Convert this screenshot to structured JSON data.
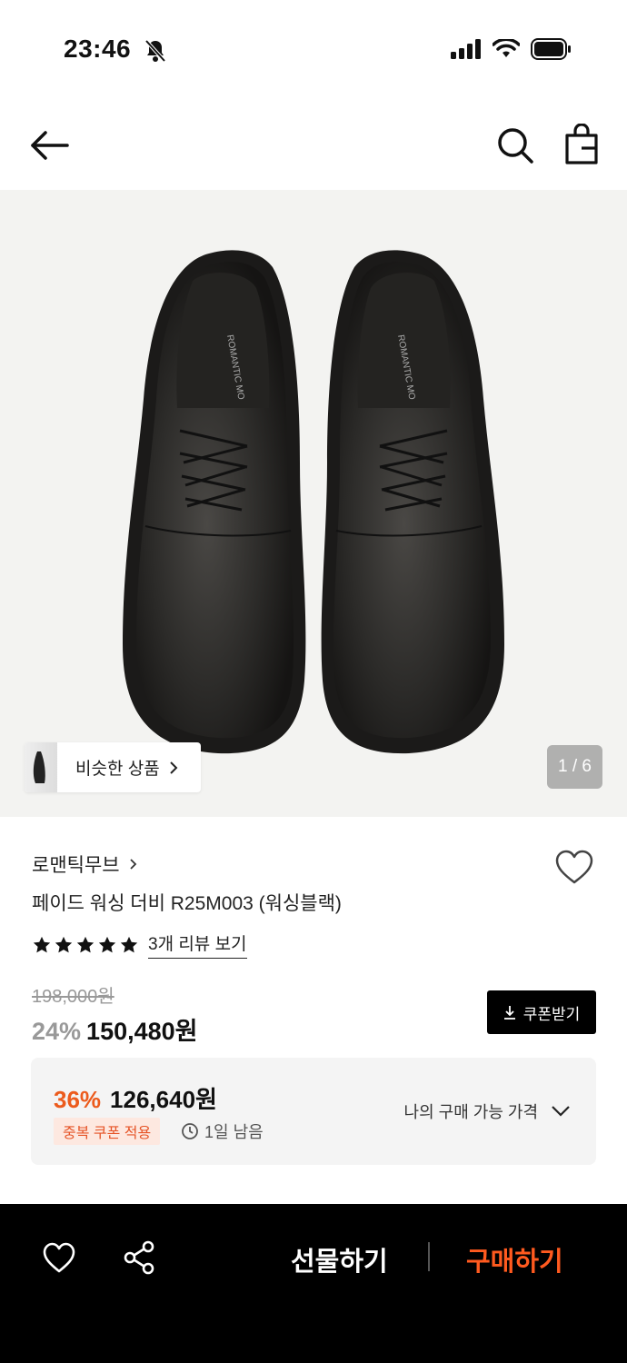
{
  "status_bar": {
    "time": "23:46"
  },
  "gallery": {
    "similar_label": "비슷한 상품",
    "counter": "1 / 6"
  },
  "product": {
    "brand": "로맨틱무브",
    "title": "페이드 워싱 더비 R25M003 (워싱블랙)",
    "rating": 5,
    "review_link": "3개 리뷰 보기",
    "original_price": "198,000원",
    "discount_rate": "24%",
    "sale_price": "150,480원",
    "coupon_button": "쿠폰받기"
  },
  "my_price": {
    "rate": "36%",
    "price": "126,640원",
    "badge": "중복 쿠폰 적용",
    "expire": "1일 남음",
    "toggle_label": "나의 구매 가능 가격"
  },
  "bottom_bar": {
    "gift_label": "선물하기",
    "buy_label": "구매하기"
  },
  "colors": {
    "accent": "#ff5a1f",
    "badge_text": "#e65427",
    "badge_bg": "#fde8e0"
  }
}
